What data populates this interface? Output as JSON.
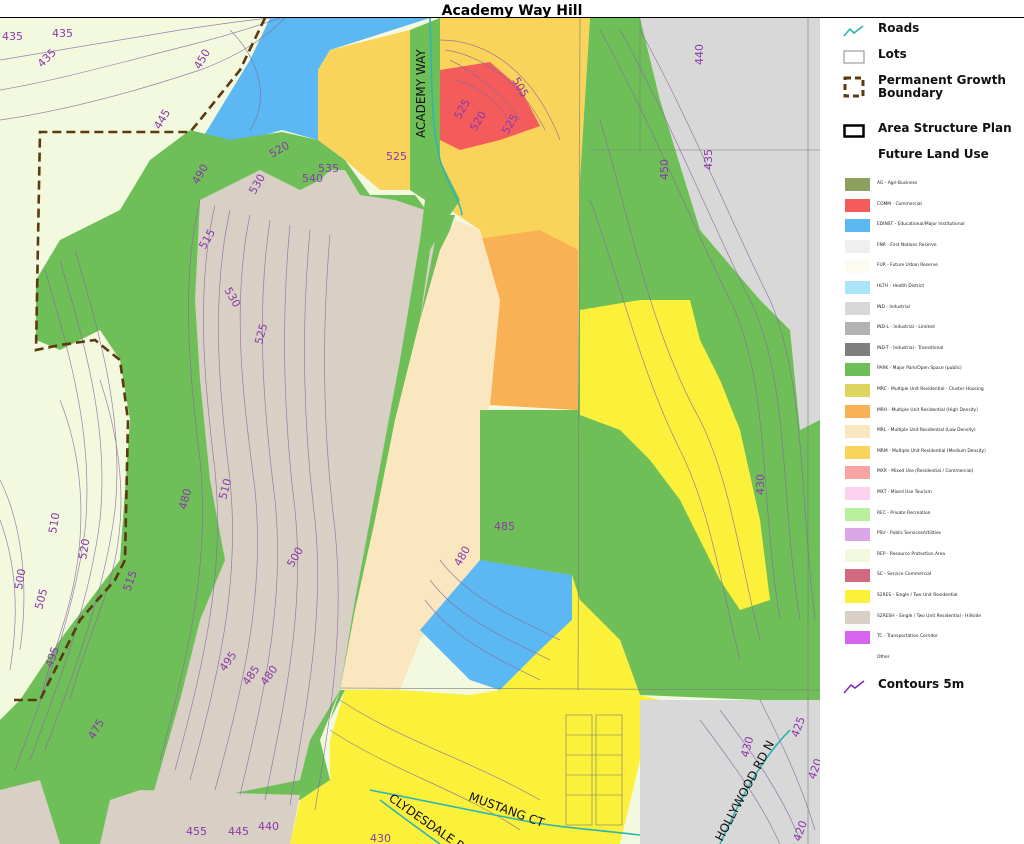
{
  "map_title": "Academy Way Hill",
  "legend": {
    "roads": "Roads",
    "lots": "Lots",
    "pgb": "Permanent Growth Boundary",
    "asp": "Area Structure Plan",
    "flu_heading": "Future Land Use",
    "contours": "Contours 5m",
    "land_use": [
      {
        "code": "AG - Agri-Business",
        "color": "#8ea060"
      },
      {
        "code": "COMM - Commercial",
        "color": "#f45b5b"
      },
      {
        "code": "EDINST - Educational/Major Institutional",
        "color": "#5cb8f2"
      },
      {
        "code": "FNR - First Nations Reserve",
        "color": "#efefef"
      },
      {
        "code": "FUR - Future Urban Reserve",
        "color": "#fbfbf1"
      },
      {
        "code": "HLTH - Health District",
        "color": "#a9e4fb"
      },
      {
        "code": "IND - Industrial",
        "color": "#d8d8d8"
      },
      {
        "code": "IND-L - Industrial - Limited",
        "color": "#b3b3b3"
      },
      {
        "code": "IND-T - Industrial - Transitional",
        "color": "#7f7f7f"
      },
      {
        "code": "PARK - Major Park/Open Space (public)",
        "color": "#6fbf58"
      },
      {
        "code": "MRC - Multiple Unit Residential - Cluster Housing",
        "color": "#dcd660"
      },
      {
        "code": "MRH - Multiple Unit Residential (High Density)",
        "color": "#f8b155"
      },
      {
        "code": "MRL - Multiple Unit Residential (Low Density)",
        "color": "#fbe7bf"
      },
      {
        "code": "MRM - Multiple Unit Residential (Medium Density)",
        "color": "#fad45a"
      },
      {
        "code": "MXR - Mixed Use (Residential / Commercial)",
        "color": "#f8a4a4"
      },
      {
        "code": "MXT - Mixed Use Tourism",
        "color": "#fbd3ee"
      },
      {
        "code": "REC - Private Recreation",
        "color": "#b7ef9c"
      },
      {
        "code": "PSU - Public Services/Utilities",
        "color": "#dba7e7"
      },
      {
        "code": "REP - Resource Protection Area",
        "color": "#f2f9df"
      },
      {
        "code": "SC - Service Commercial",
        "color": "#d06a7e"
      },
      {
        "code": "S2RES - Single / Two Unit Residential",
        "color": "#fbf03a"
      },
      {
        "code": "S2RESH - Single / Two Unit Residential - Hillside",
        "color": "#d8d0c4"
      },
      {
        "code": "TC - Transportation Corridor",
        "color": "#d764ee"
      },
      {
        "code": "Other",
        "color": "#ffffff"
      }
    ]
  },
  "roads": {
    "academy_way": "ACADEMY WAY",
    "mustang_ct": "MUSTANG CT",
    "clydesdale": "CLYDESDALE R",
    "hollywood": "HOLLYWOOD RD N"
  },
  "contour_labels": [
    "435",
    "435",
    "450",
    "445",
    "435",
    "490",
    "520",
    "540",
    "535",
    "530",
    "525",
    "515",
    "505",
    "525",
    "520",
    "525",
    "530",
    "525",
    "510",
    "480",
    "500",
    "495",
    "485",
    "480",
    "475",
    "455",
    "445",
    "440",
    "430",
    "510",
    "520",
    "500",
    "505",
    "495",
    "515",
    "485",
    "480",
    "440",
    "450",
    "435",
    "430",
    "430",
    "425",
    "420",
    "420"
  ],
  "colors": {
    "park": "#6fbf58",
    "hillside": "#d8d0c4",
    "commercial": "#f45b5b",
    "medium_density": "#fad45a",
    "high_density": "#f8b155",
    "low_density": "#fbe7bf",
    "single_two": "#fbf03a",
    "educational": "#5cb8f2",
    "resource_protection": "#f2f9df",
    "industrial": "#d8d8d8",
    "contour": "#8a6aa0",
    "boundary": "#5a3a10"
  }
}
